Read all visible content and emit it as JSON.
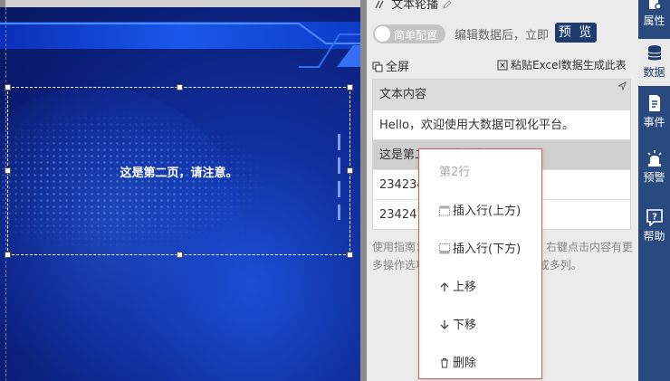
{
  "canvas": {
    "text": "这是第二页，请注意。"
  },
  "panel": {
    "title": "文本轮播",
    "toggle_label": "简单配置",
    "hint": "编辑数据后，立即",
    "preview_button": "预 览",
    "fullscreen": "全屏",
    "paste_excel": "粘贴Excel数据生成此表",
    "table": {
      "header": "文本内容",
      "rows": [
        "Hello，欢迎使用大数据可视化平台。",
        "这是第二页，请注意",
        "234234",
        "234241234"
      ]
    },
    "help_text": "使用指南：双击表格单元格可修改；右键点击内容有更多操作选项；按住“Shift”选择多行或多列。"
  },
  "context_menu": {
    "header": "第2行",
    "items": [
      {
        "label": "插入行(上方)",
        "icon": "insert-row-above-icon"
      },
      {
        "label": "插入行(下方)",
        "icon": "insert-row-below-icon"
      },
      {
        "label": "上移",
        "icon": "arrow-up-icon"
      },
      {
        "label": "下移",
        "icon": "arrow-down-icon"
      },
      {
        "label": "删除",
        "icon": "trash-icon"
      }
    ],
    "border_color": "#d35a5a"
  },
  "sidebar": {
    "items": [
      {
        "label": "属性",
        "icon": "properties-icon"
      },
      {
        "label": "数据",
        "icon": "database-icon",
        "active": true
      },
      {
        "label": "事件",
        "icon": "event-icon"
      },
      {
        "label": "预警",
        "icon": "alarm-icon"
      },
      {
        "label": "帮助",
        "icon": "help-icon"
      }
    ],
    "bg_color": "#284a7f"
  }
}
